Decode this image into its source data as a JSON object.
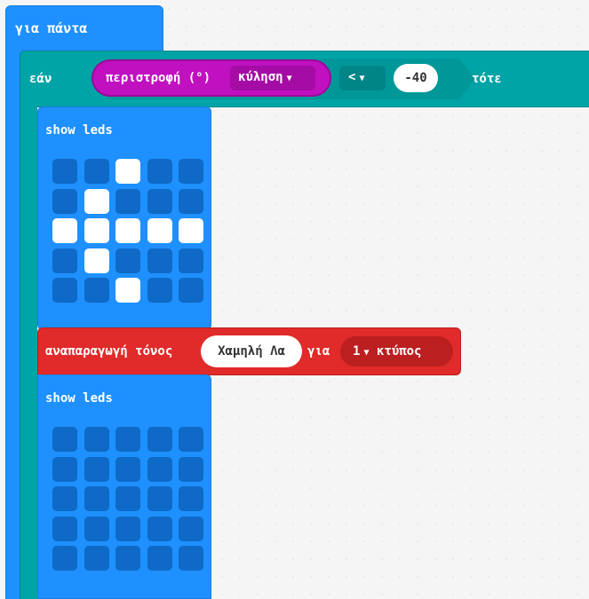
{
  "forever": {
    "label": "για πάντα"
  },
  "if_block": {
    "if_label": "εάν",
    "then_label": "τότε",
    "condition": {
      "sensor_label": "περιστροφή (°)",
      "axis_value": "κύληση",
      "operator": "<",
      "value": "-40"
    }
  },
  "show_leds_1": {
    "label": "show leds",
    "rows": [
      [
        0,
        0,
        1,
        0,
        0
      ],
      [
        0,
        1,
        0,
        0,
        0
      ],
      [
        1,
        1,
        1,
        1,
        1
      ],
      [
        0,
        1,
        0,
        0,
        0
      ],
      [
        0,
        0,
        1,
        0,
        0
      ]
    ]
  },
  "play_tone": {
    "label": "αναπαραγωγή τόνος",
    "note": "Χαμηλή Λα",
    "for_label": "για",
    "beats": "1",
    "beats_unit": "κτύπος"
  },
  "show_leds_2": {
    "label": "show leds",
    "rows": [
      [
        0,
        0,
        0,
        0,
        0
      ],
      [
        0,
        0,
        0,
        0,
        0
      ],
      [
        0,
        0,
        0,
        0,
        0
      ],
      [
        0,
        0,
        0,
        0,
        0
      ],
      [
        0,
        0,
        0,
        0,
        0
      ]
    ]
  },
  "colors": {
    "basic_blue": "#1e90ff",
    "logic_teal": "#00a4a6",
    "input_magenta": "#c010c0",
    "music_red": "#e12a2a",
    "led_on": "#ffffff",
    "led_off": "#0e6ac6"
  }
}
